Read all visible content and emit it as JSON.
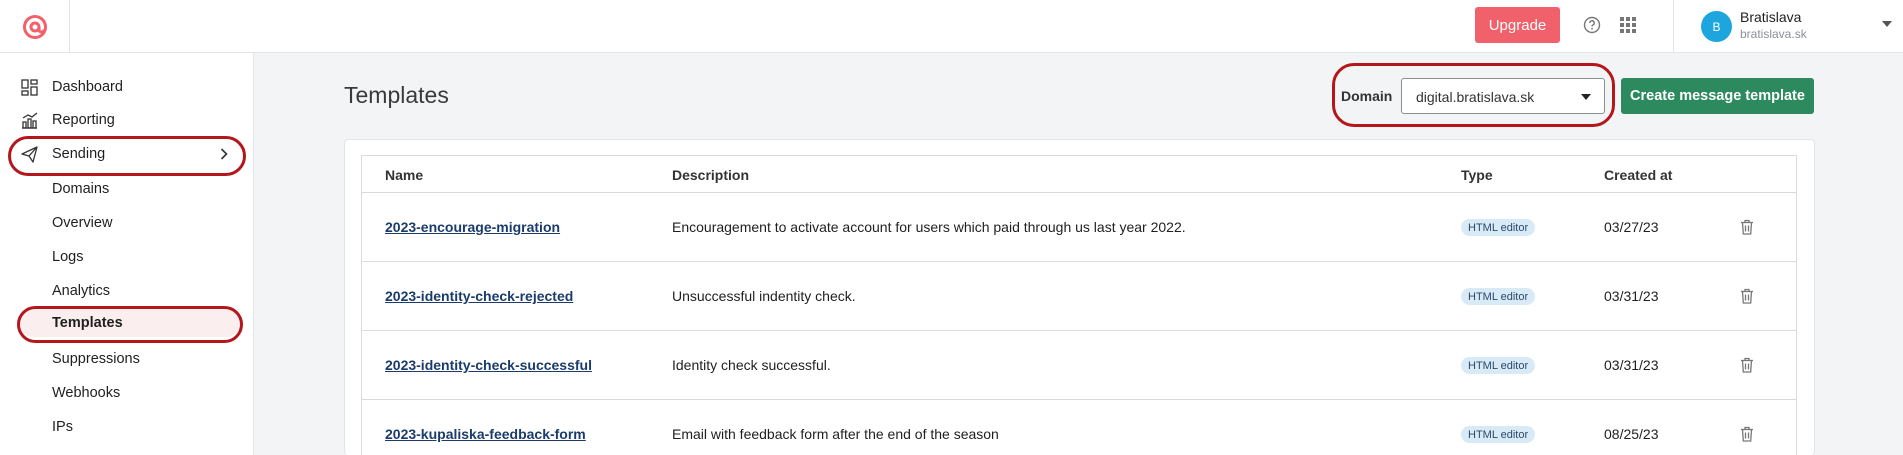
{
  "topbar": {
    "upgrade_label": "Upgrade",
    "user": {
      "initial": "B",
      "name": "Bratislava",
      "domain": "bratislava.sk"
    }
  },
  "sidebar": {
    "items": [
      {
        "label": "Dashboard",
        "icon": "dashboard-icon"
      },
      {
        "label": "Reporting",
        "icon": "chart-icon"
      },
      {
        "label": "Sending",
        "icon": "paper-plane-icon"
      }
    ],
    "sub_items": [
      "Domains",
      "Overview",
      "Logs",
      "Analytics",
      "Templates",
      "Suppressions",
      "Webhooks",
      "IPs"
    ],
    "active_sub_item": "Templates"
  },
  "main": {
    "title": "Templates",
    "domain_label": "Domain",
    "domain_value": "digital.bratislava.sk",
    "create_button": "Create message template",
    "columns": [
      "Name",
      "Description",
      "Type",
      "Created at"
    ],
    "rows": [
      {
        "name": "2023-encourage-migration",
        "description": "Encouragement to activate account for users which paid through us last year 2022.",
        "type": "HTML editor",
        "created": "03/27/23"
      },
      {
        "name": "2023-identity-check-rejected",
        "description": "Unsuccessful indentity check.",
        "type": "HTML editor",
        "created": "03/31/23"
      },
      {
        "name": "2023-identity-check-successful",
        "description": "Identity check successful.",
        "type": "HTML editor",
        "created": "03/31/23"
      },
      {
        "name": "2023-kupaliska-feedback-form",
        "description": "Email with feedback form after the end of the season",
        "type": "HTML editor",
        "created": "08/25/23"
      }
    ]
  },
  "colors": {
    "brand": "#f0616b",
    "primary_button": "#2c8a5e",
    "annotation_ring": "#b3171c",
    "avatar": "#1ca6dd"
  }
}
